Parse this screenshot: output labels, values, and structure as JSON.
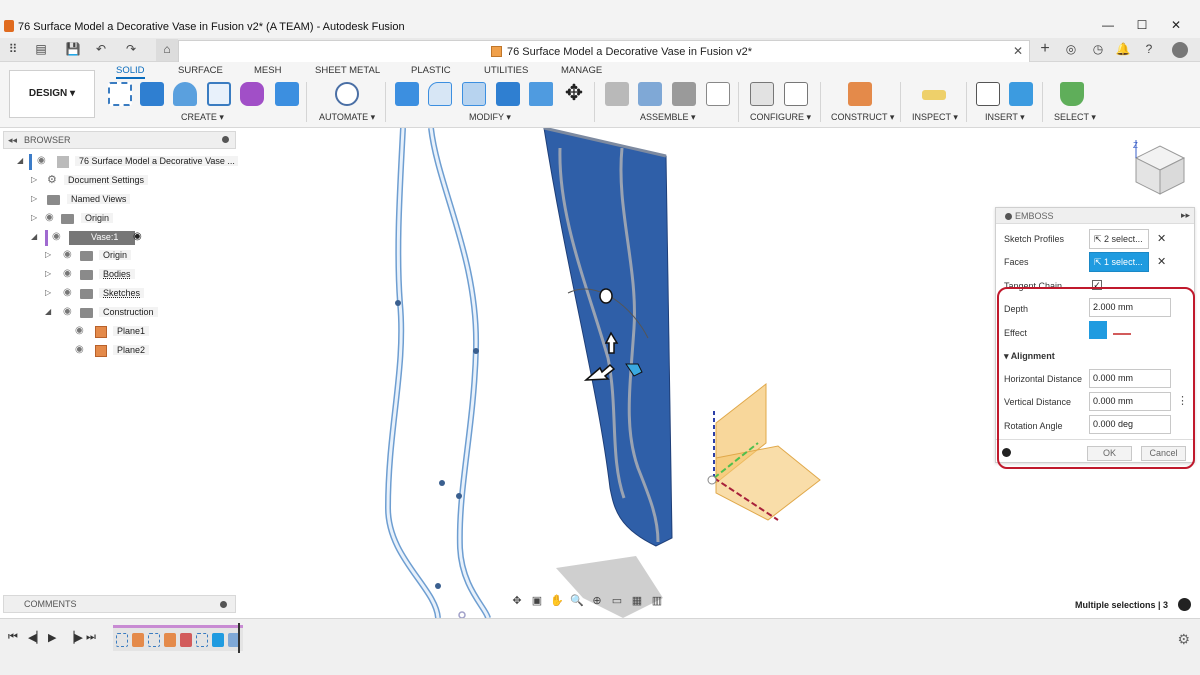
{
  "window": {
    "title": "76 Surface Model a Decorative Vase in Fusion v2* (A TEAM) - Autodesk Fusion",
    "doc_tab_title": "76 Surface Model a Decorative Vase in Fusion v2*",
    "minimize": "—",
    "maximize": "☐",
    "close": "✕"
  },
  "qat": {
    "grid": "⠿",
    "file": "▤",
    "save": "💾",
    "undo": "↶",
    "redo": "↷",
    "home": "⌂",
    "tab_close": "✕",
    "add": "+"
  },
  "ribbon": {
    "workspace": "DESIGN ▾",
    "tabs": [
      "SOLID",
      "SURFACE",
      "MESH",
      "SHEET METAL",
      "PLASTIC",
      "UTILITIES",
      "MANAGE"
    ],
    "groups": [
      "CREATE ▾",
      "AUTOMATE ▾",
      "MODIFY ▾",
      "ASSEMBLE ▾",
      "CONFIGURE ▾",
      "CONSTRUCT ▾",
      "INSPECT ▾",
      "INSERT ▾",
      "SELECT ▾"
    ]
  },
  "browser": {
    "title": "BROWSER",
    "items": [
      {
        "label": "76 Surface Model a Decorative Vase ..."
      },
      {
        "label": "Document Settings"
      },
      {
        "label": "Named Views"
      },
      {
        "label": "Origin"
      },
      {
        "label": "Vase:1"
      },
      {
        "label": "Origin"
      },
      {
        "label": "Bodies"
      },
      {
        "label": "Sketches"
      },
      {
        "label": "Construction"
      },
      {
        "label": "Plane1"
      },
      {
        "label": "Plane2"
      }
    ]
  },
  "comments": {
    "title": "COMMENTS"
  },
  "status": {
    "selection": "Multiple selections | 3"
  },
  "emboss": {
    "title": "EMBOSS",
    "sketch_profiles_label": "Sketch Profiles",
    "sketch_profiles_value": "2 select...",
    "faces_label": "Faces",
    "faces_value": "1 select...",
    "tangent_chain_label": "Tangent Chain",
    "tangent_chain_checked": "✓",
    "depth_label": "Depth",
    "depth_value": "2.000 mm",
    "effect_label": "Effect",
    "alignment_label": "Alignment",
    "hdist_label": "Horizontal Distance",
    "hdist_value": "0.000 mm",
    "vdist_label": "Vertical Distance",
    "vdist_value": "0.000 mm",
    "rot_label": "Rotation Angle",
    "rot_value": "0.000 deg",
    "ok": "OK",
    "cancel": "Cancel"
  },
  "colors": {
    "accent": "#0a6cbd",
    "vase_surface": "#2f5fa8",
    "selection": "#1f9be0",
    "annotation": "#c0192c"
  }
}
